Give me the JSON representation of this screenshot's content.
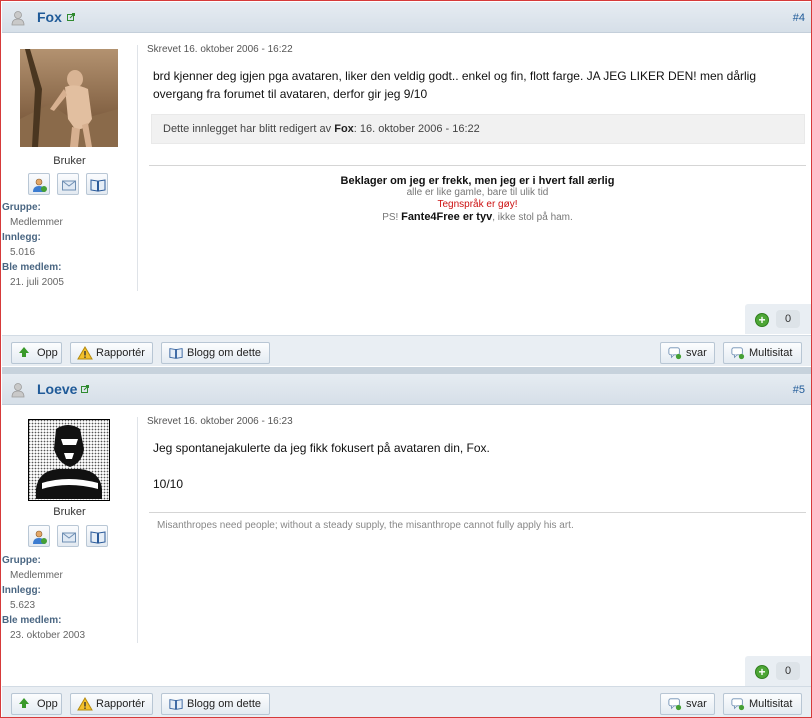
{
  "posts": [
    {
      "author": "Fox",
      "number": "#4",
      "rank": "Bruker",
      "info": [
        {
          "label": "Gruppe:",
          "value": "Medlemmer"
        },
        {
          "label": "Innlegg:",
          "value": "5.016"
        },
        {
          "label": "Ble medlem:",
          "value": "21. juli 2005"
        }
      ],
      "written": "Skrevet 16. oktober 2006 - 16:22",
      "message": [
        "brd kjenner deg igjen pga avataren, liker den veldig godt.. enkel og fin, flott farge. JA JEG LIKER DEN! men dårlig overgang fra forumet til avataren, derfor gir jeg 9/10"
      ],
      "edited": {
        "prefix": "Dette innlegget har blitt redigert av",
        "by": "Fox",
        "date": ": 16. oktober 2006 - 16:22"
      },
      "signature": {
        "line1": "Beklager om jeg er frekk, men jeg er i hvert fall ærlig",
        "line2": "alle er like gamle, bare til ulik tid",
        "line3": "Tegnspråk er gøy!",
        "line4_prefix": "PS!",
        "line4_bold": "Fante4Free er tyv",
        "line4_suffix": ", ikke stol på ham."
      },
      "reputation": "0"
    },
    {
      "author": "Loeve",
      "number": "#5",
      "rank": "Bruker",
      "info": [
        {
          "label": "Gruppe:",
          "value": "Medlemmer"
        },
        {
          "label": "Innlegg:",
          "value": "5.623"
        },
        {
          "label": "Ble medlem:",
          "value": "23. oktober 2003"
        }
      ],
      "written": "Skrevet 16. oktober 2006 - 16:23",
      "message": [
        "Jeg spontanejakulerte da jeg fikk fokusert på avataren din, Fox.",
        "10/10"
      ],
      "signature": {
        "text": "Misanthropes need people; without a steady supply, the misanthrope cannot fully apply his art."
      },
      "reputation": "0"
    }
  ],
  "footer": {
    "up": "Opp",
    "report": "Rapportér",
    "blog": "Blogg om dette",
    "reply": "svar",
    "multiquote": "Multisitat"
  },
  "colors": {
    "accent": "#1f5a98",
    "frame": "#d63a3a",
    "header": "#dbe3eb"
  }
}
